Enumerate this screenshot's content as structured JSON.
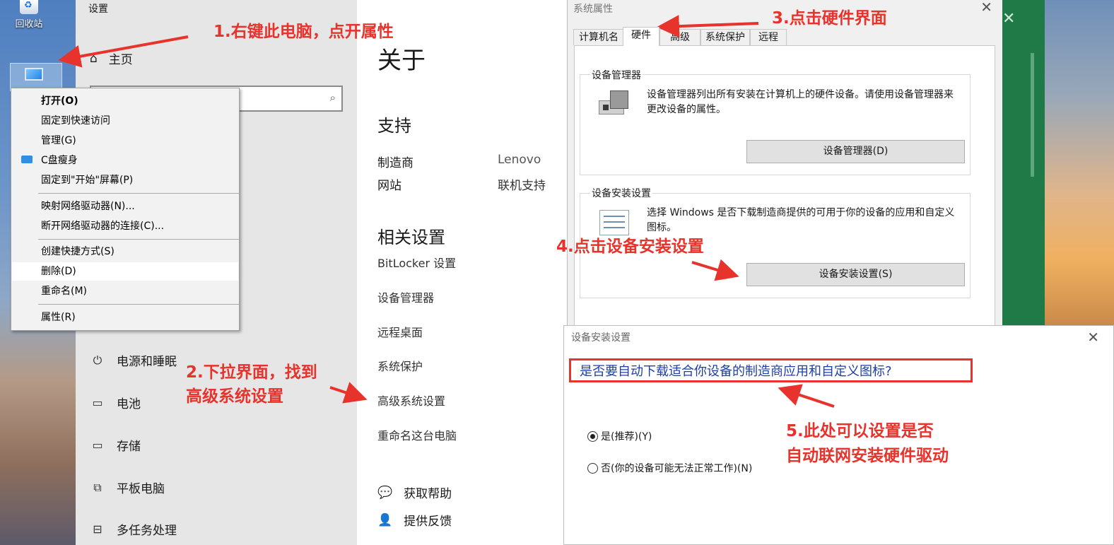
{
  "desktop": {
    "recycle_label": "回收站"
  },
  "settings": {
    "window_title": "设置",
    "home": "主页",
    "nav": [
      "电源和睡眠",
      "电池",
      "存储",
      "平板电脑",
      "多任务处理"
    ],
    "about_title": "关于",
    "support_title": "支持",
    "manufacturer_label": "制造商",
    "manufacturer_value": "Lenovo",
    "website_label": "网站",
    "website_value": "联机支持",
    "related_title": "相关设置",
    "related_links": [
      "BitLocker 设置",
      "设备管理器",
      "远程桌面",
      "系统保护",
      "高级系统设置",
      "重命名这台电脑"
    ],
    "get_help": "获取帮助",
    "feedback": "提供反馈"
  },
  "context_menu": {
    "items": [
      "打开(O)",
      "固定到快速访问",
      "管理(G)",
      "C盘瘦身",
      "固定到\"开始\"屏幕(P)",
      "映射网络驱动器(N)...",
      "断开网络驱动器的连接(C)...",
      "创建快捷方式(S)",
      "删除(D)",
      "重命名(M)",
      "属性(R)"
    ]
  },
  "system_properties": {
    "title": "系统属性",
    "tabs": [
      "计算机名",
      "硬件",
      "高级",
      "系统保护",
      "远程"
    ],
    "device_manager_group": "设备管理器",
    "device_manager_desc": "设备管理器列出所有安装在计算机上的硬件设备。请使用设备管理器来更改设备的属性。",
    "device_manager_button": "设备管理器(D)",
    "install_group": "设备安装设置",
    "install_desc": "选择 Windows 是否下载制造商提供的可用于你的设备的应用和自定义图标。",
    "install_button": "设备安装设置(S)"
  },
  "install_dialog": {
    "title": "设备安装设置",
    "question": "是否要自动下载适合你设备的制造商应用和自定义图标?",
    "option_yes": "是(推荐)(Y)",
    "option_no": "否(你的设备可能无法正常工作)(N)"
  },
  "annotations": {
    "step1": "1.右键此电脑，点开属性",
    "step2_line1": "2.下拉界面，找到",
    "step2_line2": "高级系统设置",
    "step3": "3.点击硬件界面",
    "step4": "4.点击设备安装设置",
    "step5_line1": "5.此处可以设置是否",
    "step5_line2": "自动联网安装硬件驱动"
  },
  "colors": {
    "annotation": "#e8322c",
    "question_text": "#1f3fa8",
    "green_window": "#1f7a47"
  }
}
